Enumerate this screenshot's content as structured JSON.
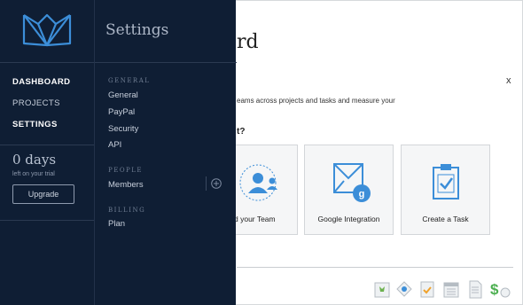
{
  "main": {
    "title": "rd",
    "close_label": "x",
    "description": "eams across projects and tasks and measure your",
    "question": "t?",
    "cards": [
      {
        "label": "d your Team",
        "icon": "team-icon"
      },
      {
        "label": "Google Integration",
        "icon": "google-integration-icon"
      },
      {
        "label": "Create a Task",
        "icon": "clipboard-check-icon"
      }
    ],
    "bottom_icons": [
      "bookmark-icon",
      "diamond-icon",
      "checklist-icon",
      "calendar-icon",
      "document-icon",
      "money-icon"
    ]
  },
  "nav": {
    "logo": "logo-icon",
    "items": [
      {
        "label": "DASHBOARD",
        "active": true
      },
      {
        "label": "PROJECTS",
        "active": false
      },
      {
        "label": "SETTINGS",
        "active": true
      }
    ],
    "trial": {
      "days": "0 days",
      "note": "left on your trial",
      "button": "Upgrade"
    }
  },
  "settings": {
    "title": "Settings",
    "sections": [
      {
        "heading": "GENERAL",
        "items": [
          "General",
          "PayPal",
          "Security",
          "API"
        ]
      },
      {
        "heading": "PEOPLE",
        "items": [
          "Members"
        ]
      },
      {
        "heading": "BILLING",
        "items": [
          "Plan"
        ]
      }
    ]
  },
  "colors": {
    "panel_bg": "#0f1e34",
    "accent_blue": "#3c8ed8",
    "text_light": "#c7cfdb"
  }
}
